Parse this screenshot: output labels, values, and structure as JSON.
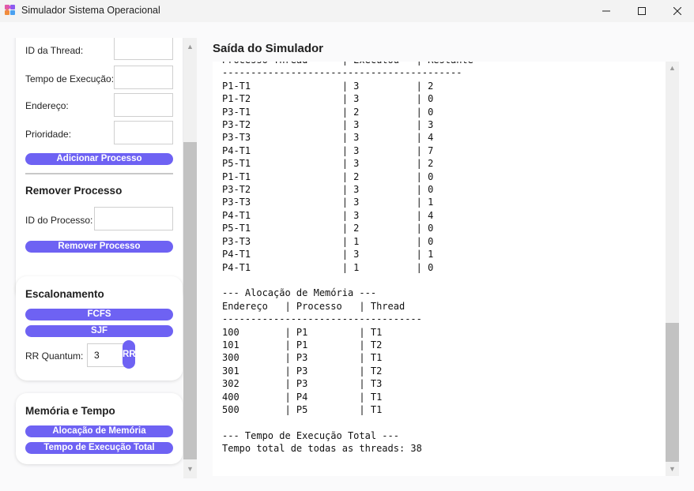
{
  "window": {
    "title": "Simulador Sistema Operacional",
    "icons": {
      "app": "puzzle-icon",
      "minimize": "minimize-icon",
      "maximize": "maximize-icon",
      "close": "close-icon"
    }
  },
  "left": {
    "form": {
      "thread_label": "ID da Thread:",
      "thread_value": "",
      "exec_time_label": "Tempo de Execução:",
      "exec_time_value": "",
      "address_label": "Endereço:",
      "address_value": "",
      "priority_label": "Prioridade:",
      "priority_value": "",
      "add_button": "Adicionar Processo"
    },
    "remove": {
      "title": "Remover Processo",
      "pid_label": "ID do Processo:",
      "pid_value": "",
      "button": "Remover Processo"
    },
    "scheduling": {
      "title": "Escalonamento",
      "fcfs": "FCFS",
      "sjf": "SJF",
      "rr_label": "RR Quantum:",
      "rr_value": "3",
      "rr_button": "RR"
    },
    "memory": {
      "title": "Memória e Tempo",
      "alloc_button": "Alocação de Memória",
      "time_button": "Tempo de Execução Total"
    }
  },
  "output": {
    "title": "Saída do Simulador",
    "lines": [
      "Processo-Thread      | Executou   | Restante",
      "------------------------------------------",
      "P1-T1                | 3          | 2",
      "P1-T2                | 3          | 0",
      "P3-T1                | 2          | 0",
      "P3-T2                | 3          | 3",
      "P3-T3                | 3          | 4",
      "P4-T1                | 3          | 7",
      "P5-T1                | 3          | 2",
      "P1-T1                | 2          | 0",
      "P3-T2                | 3          | 0",
      "P3-T3                | 3          | 1",
      "P4-T1                | 3          | 4",
      "P5-T1                | 2          | 0",
      "P3-T3                | 1          | 0",
      "P4-T1                | 3          | 1",
      "P4-T1                | 1          | 0",
      "",
      "--- Alocação de Memória ---",
      "Endereço   | Processo   | Thread",
      "-----------------------------------",
      "100        | P1         | T1",
      "101        | P1         | T2",
      "300        | P3         | T1",
      "301        | P3         | T2",
      "302        | P3         | T3",
      "400        | P4         | T1",
      "500        | P5         | T1",
      "",
      "--- Tempo de Execução Total ---",
      "Tempo total de todas as threads: 38"
    ]
  },
  "colors": {
    "accent": "#6e62f3",
    "background": "#fafafb",
    "card": "#ffffff"
  }
}
